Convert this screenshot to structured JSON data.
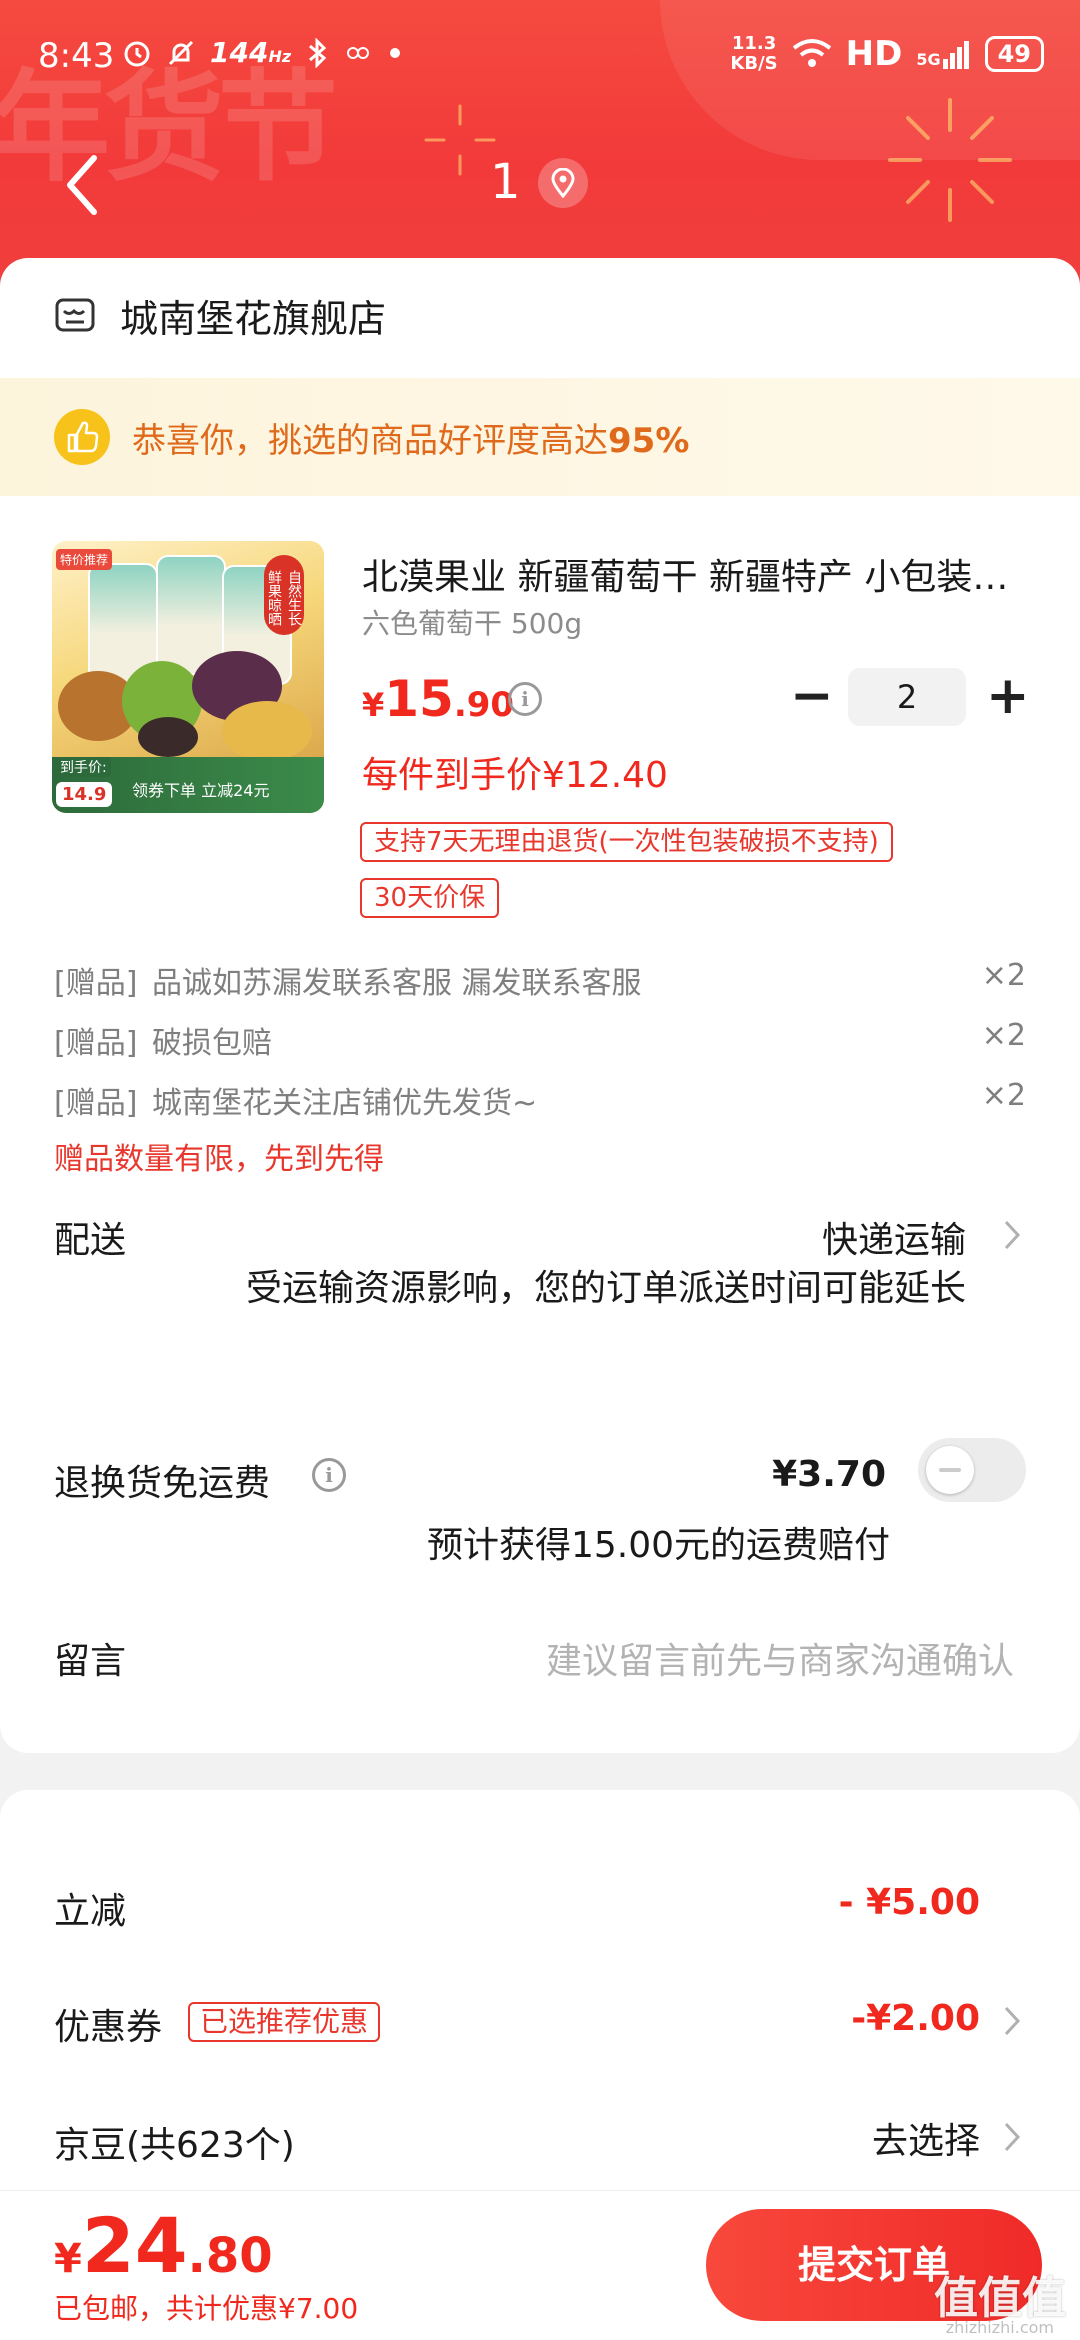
{
  "status_bar": {
    "time": "8:43",
    "refresh_rate": "144",
    "refresh_unit": "Hz",
    "net_speed_value": "11.3",
    "net_speed_unit": "KB/S",
    "hd": "HD",
    "network": "5G",
    "battery": "49"
  },
  "nav": {
    "title": "1"
  },
  "header_decor": {
    "festival_text": "年货节"
  },
  "shop": {
    "name": "城南堡花旗舰店"
  },
  "promo": {
    "text_prefix": "恭喜你，挑选的商品好评度高达",
    "rating": "95%"
  },
  "product": {
    "title": "北漠果业 新疆葡萄干 新疆特产 小包装 零食",
    "spec": "六色葡萄干 500g",
    "price_currency": "¥",
    "price_int": "15",
    "price_dec": ".90",
    "quantity": "2",
    "final_price": "每件到手价¥12.40",
    "tags": [
      "支持7天无理由退货(一次性包装破损不支持)",
      "30天价保"
    ],
    "image_text": {
      "corner": "特价推荐",
      "side_tag": "自然生长 鲜果晾晒",
      "price_label": "到手价:",
      "price": "14.9",
      "coupon": "领券下单 立减24元"
    }
  },
  "gifts": {
    "items": [
      {
        "prefix": "[赠品]",
        "name": "品诚如苏漏发联系客服 漏发联系客服",
        "qty": "×2"
      },
      {
        "prefix": "[赠品]",
        "name": "破损包赔",
        "qty": "×2"
      },
      {
        "prefix": "[赠品]",
        "name": "城南堡花关注店铺优先发货~",
        "qty": "×2"
      }
    ],
    "note": "赠品数量有限，先到先得"
  },
  "shipping": {
    "label": "配送",
    "value": "快递运输",
    "warning": "受运输资源影响，您的订单派送时间可能延长"
  },
  "return_fee": {
    "label": "退换货免运费",
    "price": "¥3.70",
    "note": "预计获得15.00元的运费赔付"
  },
  "message": {
    "label": "留言",
    "placeholder": "建议留言前先与商家沟通确认"
  },
  "discounts": {
    "instant_label": "立减",
    "instant_value": "- ¥5.00",
    "coupon_label": "优惠券",
    "coupon_tag": "已选推荐优惠",
    "coupon_value": "-¥2.00",
    "beans_label": "京豆(共623个)",
    "beans_action": "去选择"
  },
  "bottom": {
    "currency": "¥",
    "total_int": "24",
    "total_dec": ".80",
    "note": "已包邮，共计优惠¥7.00",
    "submit": "提交订单"
  },
  "watermark": {
    "text": "值值值",
    "sub": "zhizhizhi.com"
  },
  "colors": {
    "header_red": "#f23a3a",
    "accent_red": "#f0281e",
    "promo_orange": "#e06a1b",
    "promo_bg": "#fdf4dc"
  },
  "icons": [
    "back-icon",
    "location-icon",
    "shop-icon",
    "thumbs-up-icon",
    "info-icon",
    "chevron-right-icon",
    "alarm-icon",
    "mute-icon",
    "bluetooth-icon",
    "wifi-icon",
    "signal-icon",
    "battery-icon"
  ]
}
